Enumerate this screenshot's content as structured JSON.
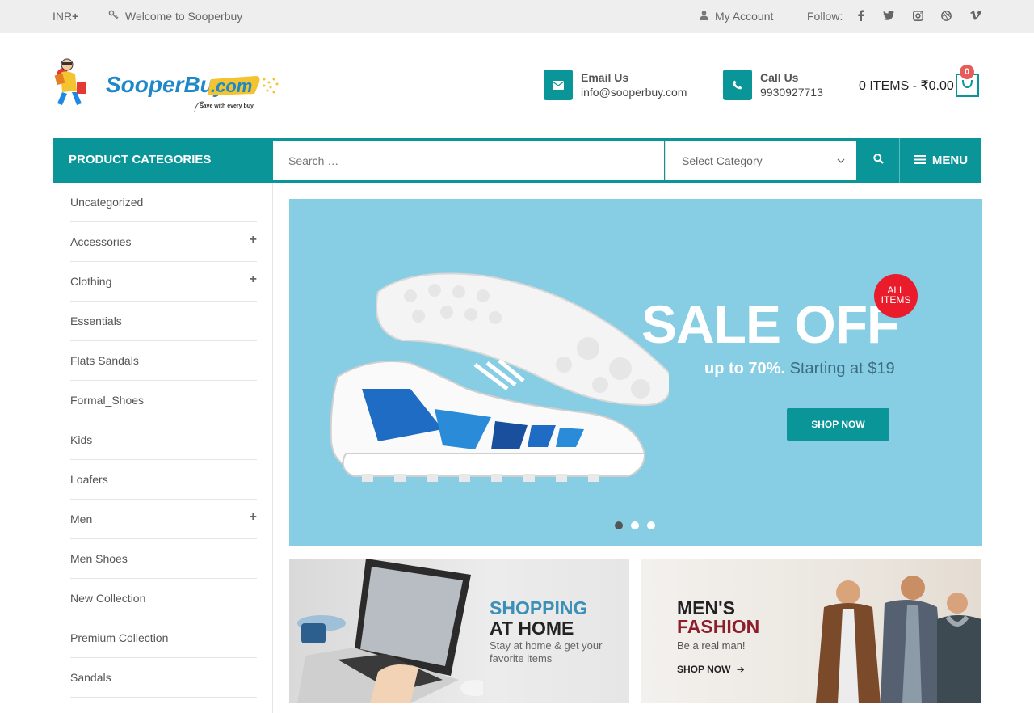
{
  "topbar": {
    "currency": "INR",
    "welcome": "Welcome to Sooperbuy",
    "account": "My Account",
    "follow": "Follow:",
    "social": [
      "facebook-icon",
      "twitter-icon",
      "instagram-icon",
      "dribbble-icon",
      "vimeo-icon"
    ]
  },
  "header": {
    "logo_text": "SooperBuy",
    "logo_domain": ".com",
    "logo_tagline": "Save with every buy",
    "email_title": "Email Us",
    "email_value": "info@sooperbuy.com",
    "call_title": "Call Us",
    "call_value": "9930927713",
    "cart_label": "0 ITEMS - ₹0.00",
    "cart_count": "0"
  },
  "nav": {
    "categories_label": "PRODUCT CATEGORIES",
    "search_placeholder": "Search …",
    "select_category": "Select Category",
    "menu_label": "MENU"
  },
  "sidebar": {
    "items": [
      {
        "label": "Uncategorized",
        "expandable": false
      },
      {
        "label": "Accessories",
        "expandable": true
      },
      {
        "label": "Clothing",
        "expandable": true
      },
      {
        "label": "Essentials",
        "expandable": false
      },
      {
        "label": "Flats Sandals",
        "expandable": false
      },
      {
        "label": "Formal_Shoes",
        "expandable": false
      },
      {
        "label": "Kids",
        "expandable": false
      },
      {
        "label": "Loafers",
        "expandable": false
      },
      {
        "label": "Men",
        "expandable": true
      },
      {
        "label": "Men Shoes",
        "expandable": false
      },
      {
        "label": "New Collection",
        "expandable": false
      },
      {
        "label": "Premium Collection",
        "expandable": false
      },
      {
        "label": "Sandals",
        "expandable": false
      }
    ]
  },
  "hero": {
    "title": "SALE OFF",
    "badge_line1": "ALL",
    "badge_line2": "ITEMS",
    "sub_bold": "up to 70%.",
    "sub_rest": "Starting at $19",
    "button": "SHOP NOW",
    "slides_count": 3,
    "active_slide": 1
  },
  "banners": {
    "left": {
      "line1": "SHOPPING",
      "line2": "AT HOME",
      "desc": "Stay at home & get your favorite items"
    },
    "right": {
      "line1": "MEN'S",
      "line2": "FASHION",
      "desc": "Be a real man!",
      "cta": "SHOP NOW"
    }
  },
  "colors": {
    "accent": "#0a9699",
    "hero_bg": "#87cde3",
    "badge_red": "#ea1c2c",
    "topbar_bg": "#eeeeee"
  }
}
